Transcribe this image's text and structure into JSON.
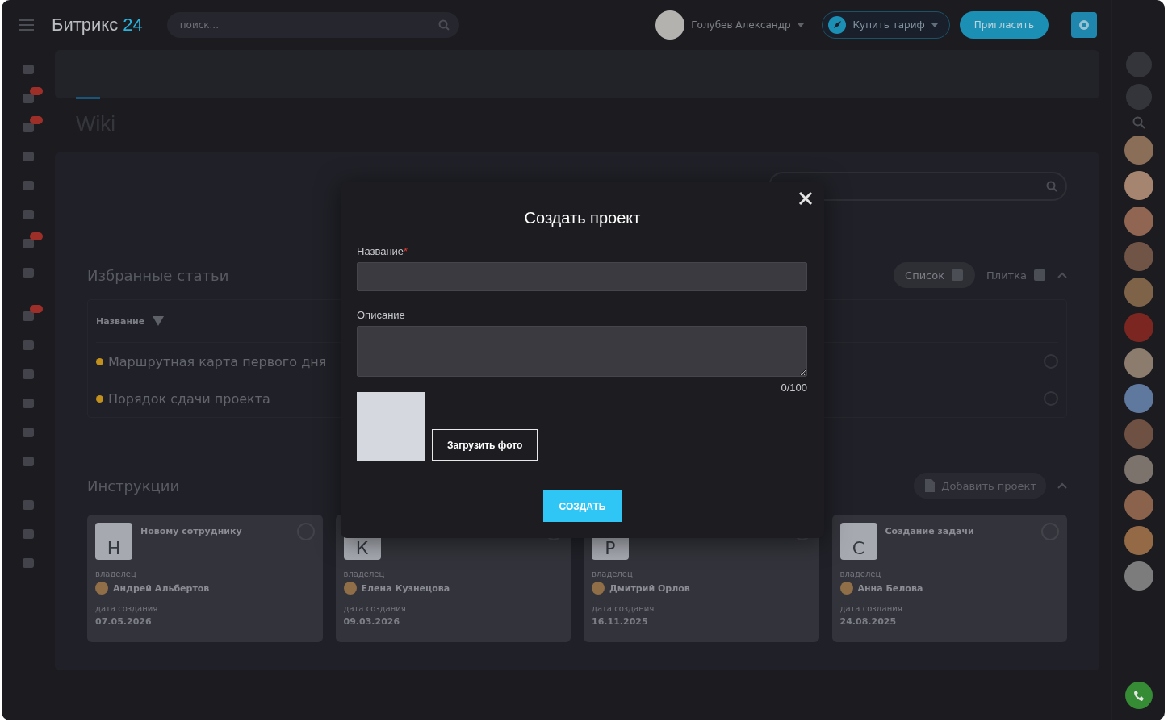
{
  "header": {
    "logo_text": "Битрикс",
    "logo_number": "24",
    "search_placeholder": "поиск...",
    "user_name": "Голубев Александр",
    "buy_button": "Купить тариф",
    "invite_button": "Пригласить"
  },
  "sidebar": {
    "items": [
      {
        "counter": false
      },
      {
        "counter": true
      },
      {
        "counter": true
      },
      {
        "counter": false
      },
      {
        "counter": false
      },
      {
        "counter": false
      },
      {
        "counter": true
      },
      {
        "counter": false
      },
      {
        "counter": true
      },
      {
        "counter": false
      },
      {
        "counter": false
      },
      {
        "counter": false
      },
      {
        "counter": false
      },
      {
        "counter": false
      },
      {
        "counter": false
      },
      {
        "counter": false
      },
      {
        "counter": false
      }
    ]
  },
  "page": {
    "title": "Wiki"
  },
  "favorites": {
    "title": "Избранные статьи",
    "view_buttons": [
      {
        "label": "Список",
        "selected": true
      },
      {
        "label": "Плитка",
        "selected": false
      }
    ],
    "column": "Название",
    "rows": [
      {
        "title": "Маршрутная карта первого дня"
      },
      {
        "title": "Порядок сдачи проекта"
      }
    ]
  },
  "instructions": {
    "title": "Инструкции",
    "add_button": "Добавить проект",
    "cards": [
      {
        "letter": "Н",
        "title": "Новому сотруднику",
        "owner_label": "владелец",
        "owner": "Андрей Альбертов",
        "date_label": "дата создания",
        "date": "07.05.2026"
      },
      {
        "letter": "К",
        "owner_label": "владелец",
        "owner": "Елена Кузнецова",
        "date_label": "дата создания",
        "date": "09.03.2026"
      },
      {
        "letter": "Р",
        "owner_label": "владелец",
        "owner": "Дмитрий Орлов",
        "date_label": "дата создания",
        "date": "16.11.2025"
      },
      {
        "letter": "С",
        "title": "Создание задачи",
        "owner_label": "владелец",
        "owner": "Анна Белова",
        "date_label": "дата создания",
        "date": "24.08.2025"
      }
    ]
  },
  "modal": {
    "title": "Создать проект",
    "name_label": "Название",
    "required_mark": "*",
    "description_label": "Описание",
    "counter": "0/100",
    "upload_button": "Загрузить фото",
    "submit_button": "СОЗДАТЬ"
  }
}
